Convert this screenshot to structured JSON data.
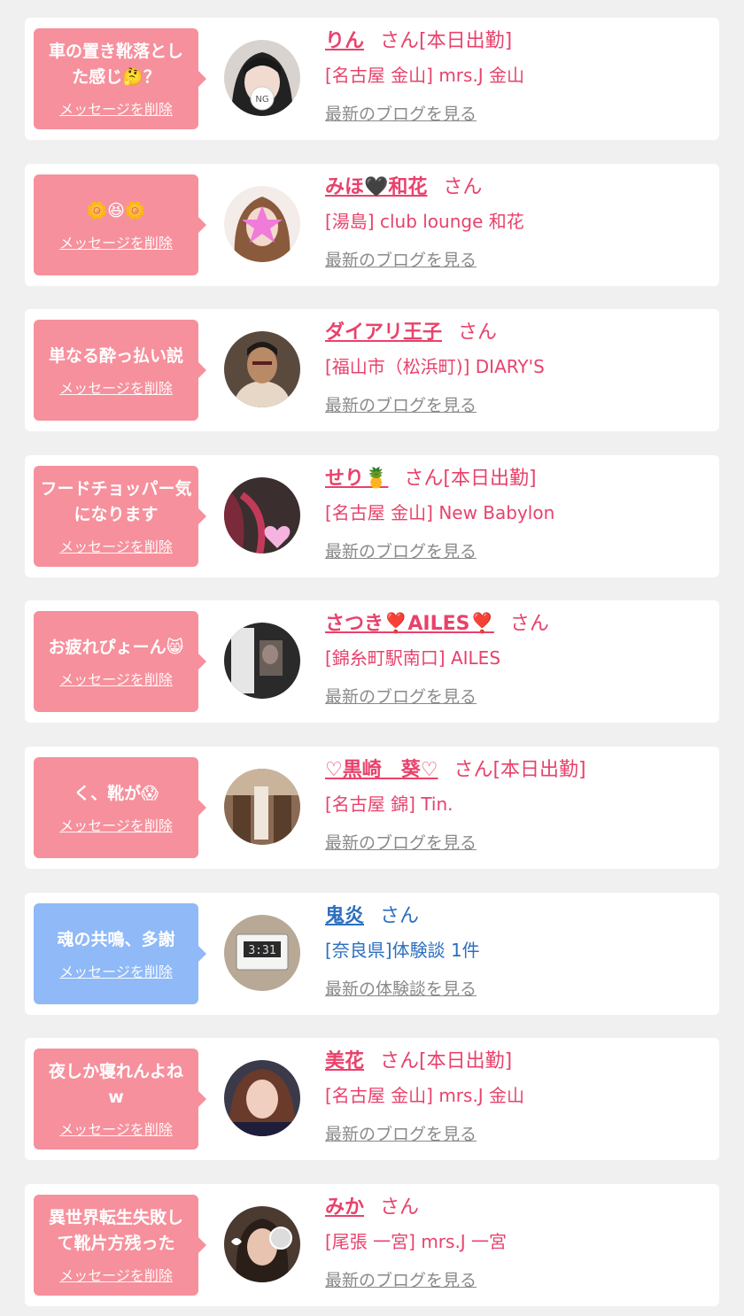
{
  "colors": {
    "pink_bubble": "#f6909c",
    "blue_bubble": "#8fb9f7",
    "pink_text": "#e8426b",
    "blue_text": "#2d6fbd",
    "link_gray": "#8a8a8a"
  },
  "cards": [
    {
      "bubble": "pink",
      "message": "車の置き靴落とした感じ🤔？",
      "delete_label": "メッセージを削除",
      "avatar": "avatar-ng-sticker",
      "name": "りん",
      "suffix": "さん[本日出勤]",
      "location": "[名古屋 金山] mrs.J 金山",
      "link": "最新のブログを見る"
    },
    {
      "bubble": "pink",
      "message": "🌼😆🌼",
      "delete_label": "メッセージを削除",
      "avatar": "avatar-star-sticker",
      "name": "みほ🖤和花",
      "suffix": "さん",
      "location": "[湯島] club lounge 和花",
      "link": "最新のブログを見る"
    },
    {
      "bubble": "pink",
      "message": "単なる酔っ払い説",
      "delete_label": "メッセージを削除",
      "avatar": "avatar-warrior",
      "name": "ダイアリ王子",
      "suffix": "さん",
      "location": "[福山市（松浜町)] DIARY'S",
      "link": "最新のブログを見る"
    },
    {
      "bubble": "pink",
      "message": "フードチョッパー気になります",
      "delete_label": "メッセージを削除",
      "avatar": "avatar-heart-sticker",
      "name": "せり🍍",
      "suffix": "さん[本日出勤]",
      "location": "[名古屋 金山] New Babylon",
      "link": "最新のブログを見る"
    },
    {
      "bubble": "pink",
      "message": "お疲れぴょーん😸",
      "delete_label": "メッセージを削除",
      "avatar": "avatar-mirror",
      "name": "さつき❣️AILES❣️",
      "suffix": "さん",
      "location": "[錦糸町駅南口] AILES",
      "link": "最新のブログを見る"
    },
    {
      "bubble": "pink",
      "message": "く、靴が😱",
      "delete_label": "メッセージを削除",
      "avatar": "avatar-room",
      "name": "♡黒崎　葵♡",
      "suffix": "さん[本日出勤]",
      "location": "[名古屋 錦] Tin.",
      "link": "最新のブログを見る"
    },
    {
      "bubble": "blue",
      "message": "魂の共鳴、多謝",
      "delete_label": "メッセージを削除",
      "avatar": "avatar-timer",
      "name": "鬼炎",
      "suffix": "さん",
      "location": "[奈良県]体験談 1件",
      "link": "最新の体験談を見る"
    },
    {
      "bubble": "pink",
      "message": "夜しか寝れんよね\nw",
      "delete_label": "メッセージを削除",
      "avatar": "avatar-portrait",
      "name": "美花",
      "suffix": "さん[本日出勤]",
      "location": "[名古屋 金山] mrs.J 金山",
      "link": "最新のブログを見る"
    },
    {
      "bubble": "pink",
      "message": "異世界転生失敗して靴片方残った",
      "delete_label": "メッセージを削除",
      "avatar": "avatar-cat-sticker",
      "name": "みか",
      "suffix": "さん",
      "location": "[尾張 一宮] mrs.J 一宮",
      "link": "最新のブログを見る"
    }
  ]
}
